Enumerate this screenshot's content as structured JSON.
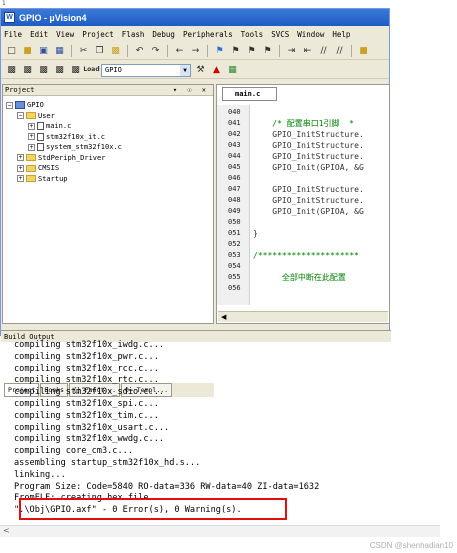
{
  "window": {
    "title": "GPIO  - µVision4",
    "app_icon": "W",
    "corner_label": "1"
  },
  "menubar": {
    "items": [
      "File",
      "Edit",
      "View",
      "Project",
      "Flash",
      "Debug",
      "Peripherals",
      "Tools",
      "SVCS",
      "Window",
      "Help"
    ]
  },
  "toolbar": {
    "target": "GPIO",
    "load_label": "Load"
  },
  "project_panel": {
    "title": "Project",
    "pin_controls": "▾ ☉ ✕",
    "tree": [
      {
        "label": "GPIO",
        "level": 0,
        "kind": "project",
        "expander": "−"
      },
      {
        "label": "User",
        "level": 1,
        "kind": "folder",
        "expander": "−"
      },
      {
        "label": "main.c",
        "level": 2,
        "kind": "file",
        "expander": "+"
      },
      {
        "label": "stm32f10x_it.c",
        "level": 2,
        "kind": "file",
        "expander": "+"
      },
      {
        "label": "system_stm32f10x.c",
        "level": 2,
        "kind": "file",
        "expander": "+"
      },
      {
        "label": "StdPeriph_Driver",
        "level": 1,
        "kind": "folder",
        "expander": "+"
      },
      {
        "label": "CMSIS",
        "level": 1,
        "kind": "folder",
        "expander": "+"
      },
      {
        "label": "Startup",
        "level": 1,
        "kind": "folder",
        "expander": "+"
      }
    ],
    "tabs": [
      "Project",
      "Books",
      "{} Funct...",
      "0→ Templ..."
    ]
  },
  "editor": {
    "tab": "main.c",
    "lines": [
      {
        "num": "040",
        "text": ""
      },
      {
        "num": "041",
        "text": "    /* 配置串口1引脚  *",
        "cls": "c-comment"
      },
      {
        "num": "042",
        "text": "    GPIO_InitStructure.",
        "cls": "c-norm"
      },
      {
        "num": "043",
        "text": "    GPIO_InitStructure.",
        "cls": "c-norm"
      },
      {
        "num": "044",
        "text": "    GPIO_InitStructure.",
        "cls": "c-norm"
      },
      {
        "num": "045",
        "text": "    GPIO_Init(GPIOA, &G",
        "cls": "c-norm"
      },
      {
        "num": "046",
        "text": ""
      },
      {
        "num": "047",
        "text": "    GPIO_InitStructure.",
        "cls": "c-norm"
      },
      {
        "num": "048",
        "text": "    GPIO_InitStructure.",
        "cls": "c-norm"
      },
      {
        "num": "049",
        "text": "    GPIO_Init(GPIOA, &G",
        "cls": "c-norm"
      },
      {
        "num": "050",
        "text": ""
      },
      {
        "num": "051",
        "text": "}",
        "cls": "c-norm"
      },
      {
        "num": "052",
        "text": ""
      },
      {
        "num": "053",
        "text": "/*********************",
        "cls": "c-comment"
      },
      {
        "num": "054",
        "text": ""
      },
      {
        "num": "055",
        "text": "      全部中断在此配置",
        "cls": "c-comment"
      },
      {
        "num": "056",
        "text": ""
      }
    ]
  },
  "build_output": {
    "title": "Build Output",
    "lines": [
      "compiling stm32f10x_iwdg.c...",
      "compiling stm32f10x_pwr.c...",
      "compiling stm32f10x_rcc.c...",
      "compiling stm32f10x_rtc.c...",
      "compiling stm32f10x_sdio.c...",
      "compiling stm32f10x_spi.c...",
      "compiling stm32f10x_tim.c...",
      "compiling stm32f10x_usart.c...",
      "compiling stm32f10x_wwdg.c...",
      "compiling core_cm3.c...",
      "assembling startup_stm32f10x_hd.s...",
      "linking...",
      "Program Size: Code=5840 RO-data=336 RW-data=40 ZI-data=1632",
      "FromELF: creating hex file...",
      "\".\\Obj\\GPIO.axf\" - 0 Error(s), 0 Warning(s)."
    ],
    "scroll_glyph": "<"
  },
  "watermark": "CSDN @shenhadian10",
  "colors": {
    "title_bar": "#1e5bc6",
    "highlight_box": "#e01010",
    "comment": "#008000"
  }
}
